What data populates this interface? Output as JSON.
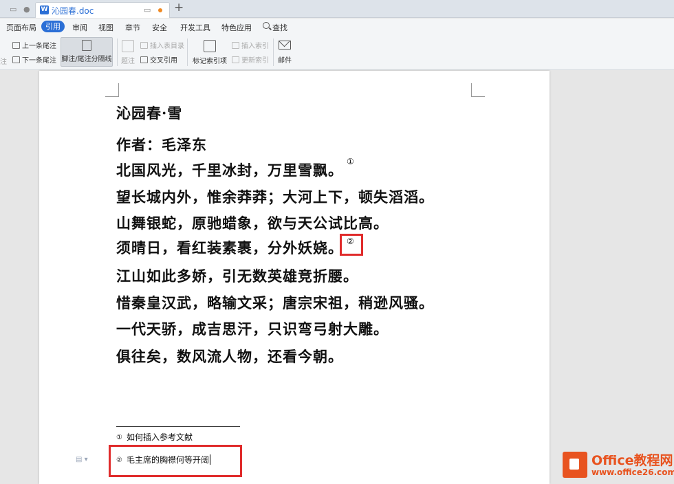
{
  "tabbar": {
    "doc_title": "沁园春.doc",
    "new_tab": "+"
  },
  "menubar": {
    "items": [
      "页面布局",
      "引用",
      "审阅",
      "视图",
      "章节",
      "安全",
      "开发工具",
      "特色应用",
      "查找"
    ],
    "active": "引用"
  },
  "ribbon": {
    "prev_endnote": "上一条尾注",
    "next_endnote": "下一条尾注",
    "separator": "脚注/尾注分隔线",
    "caption": "题注",
    "insert_table_of_figures": "插入表目录",
    "cross_reference": "交叉引用",
    "mark_index_entry": "标记索引项",
    "insert_index": "插入索引",
    "update_index": "更新索引",
    "mail": "邮件",
    "clipped_left": "注"
  },
  "document": {
    "title": "沁园春·雪",
    "author": "作者：毛泽东",
    "lines": [
      "北国风光，千里冰封，万里雪飘。",
      "望长城内外，惟余莽莽；大河上下，顿失滔滔。",
      "山舞银蛇，原驰蜡象，欲与天公试比高。",
      "须晴日，看红装素裹，分外妖娆。",
      "江山如此多娇，引无数英雄竞折腰。",
      "惜秦皇汉武，略输文采；唐宗宋祖，稍逊风骚。",
      "一代天骄，成吉思汗，只识弯弓射大雕。",
      "俱往矣，数风流人物，还看今朝。"
    ],
    "footnote_ref_1": "①",
    "footnote_ref_2": "②",
    "footnotes": [
      {
        "num": "①",
        "text": "如何插入参考文献"
      },
      {
        "num": "②",
        "text": "毛主席的胸襟何等开阔"
      }
    ]
  },
  "watermark": {
    "name": "Office教程网",
    "url": "www.office26.com"
  },
  "colors": {
    "accent": "#2b6fd6",
    "highlight": "#e02b2b",
    "watermark": "#e8531f"
  }
}
